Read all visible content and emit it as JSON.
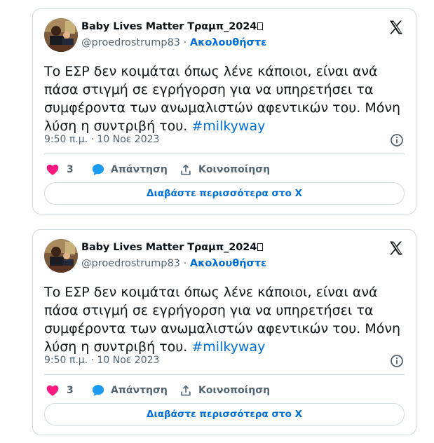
{
  "tweets": [
    {
      "author": {
        "name": "Baby Lives Matter Τραμπ_2024",
        "handle": "@proedrostrump83",
        "follow_label": "Ακολουθήστε"
      },
      "text": "Το ΕΣΡ δεν κοιμάται όπως λένε κάποιοι, είναι ανά πάσα στιγμή σε εγρήγορση για να υπηρετήσει τα συμφέροντα των ανωμαλιστών αφεντικών του. Μόνη λύση η συντριβή του.",
      "hashtag": "#milkyway",
      "time": "9:50 π.μ.",
      "date": "10 Νοε 2023",
      "likes": "3",
      "reply_label": "Απάντηση",
      "share_label": "Κοινοποίηση",
      "read_more": "Διαβάστε περισσότερα στο X"
    },
    {
      "author": {
        "name": "Baby Lives Matter Τραμπ_2024",
        "handle": "@proedrostrump83",
        "follow_label": "Ακολουθήστε"
      },
      "text": "Το ΕΣΡ δεν κοιμάται όπως λένε κάποιοι, είναι ανά πάσα στιγμή σε εγρήγορση για να υπηρετήσει τα συμφέροντα των ανωμαλιστών αφεντικών του. Μόνη λύση η συντριβή του.",
      "hashtag": "#milkyway",
      "time": "9:50 π.μ.",
      "date": "10 Νοε 2023",
      "likes": "3",
      "reply_label": "Απάντηση",
      "share_label": "Κοινοποίηση",
      "read_more": "Διαβάστε περισσότερα στο X"
    }
  ],
  "colors": {
    "link": "#006fd6",
    "secondary": "#536471",
    "border": "#cfd9de",
    "like": "#f91880",
    "reply": "#1d9bf0"
  },
  "icons": [
    "x-logo-icon",
    "info-icon",
    "heart-icon",
    "reply-bubble-icon",
    "share-icon"
  ]
}
